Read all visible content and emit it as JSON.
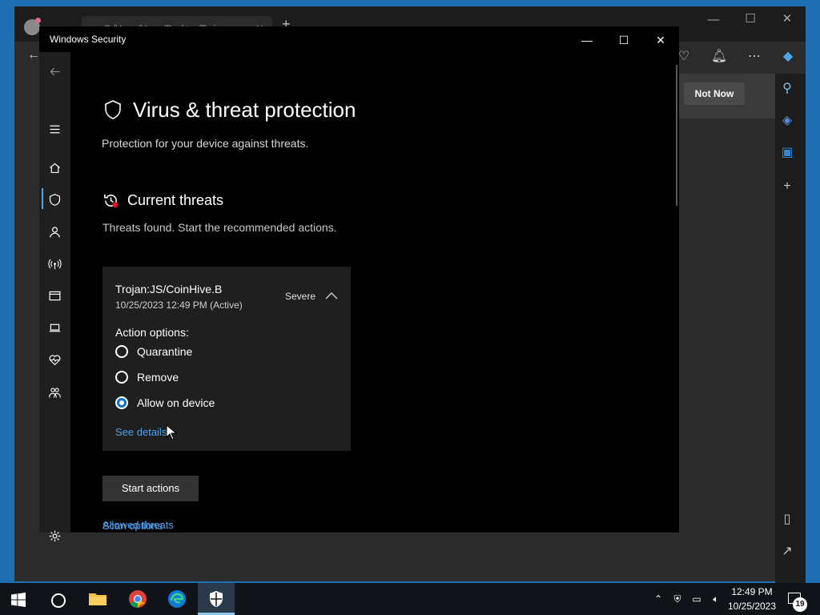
{
  "edge": {
    "tab_title": "C:/Users/Vuser/Desktop/Trojan",
    "not_now_label": "Not Now"
  },
  "window": {
    "title": "Windows Security"
  },
  "page": {
    "title": "Virus & threat protection",
    "subtitle": "Protection for your device against threats."
  },
  "current_threats": {
    "title": "Current threats",
    "subtitle": "Threats found. Start the recommended actions.",
    "threat": {
      "name": "Trojan:JS/CoinHive.B",
      "date": "10/25/2023 12:49 PM (Active)",
      "severity": "Severe",
      "action_label": "Action options:",
      "options": [
        {
          "label": "Quarantine",
          "selected": false
        },
        {
          "label": "Remove",
          "selected": false
        },
        {
          "label": "Allow on device",
          "selected": true
        }
      ],
      "see_details": "See details"
    },
    "start_actions_label": "Start actions",
    "scan_options_link": "Scan options",
    "allowed_threats_link": "Allowed threats"
  },
  "taskbar": {
    "time": "12:49 PM",
    "date": "10/25/2023",
    "notification_count": "19"
  },
  "colors": {
    "accent_link": "#4aa3f0",
    "radio_selected": "#0d6fc8",
    "nav_active": "#4ea7e8"
  }
}
